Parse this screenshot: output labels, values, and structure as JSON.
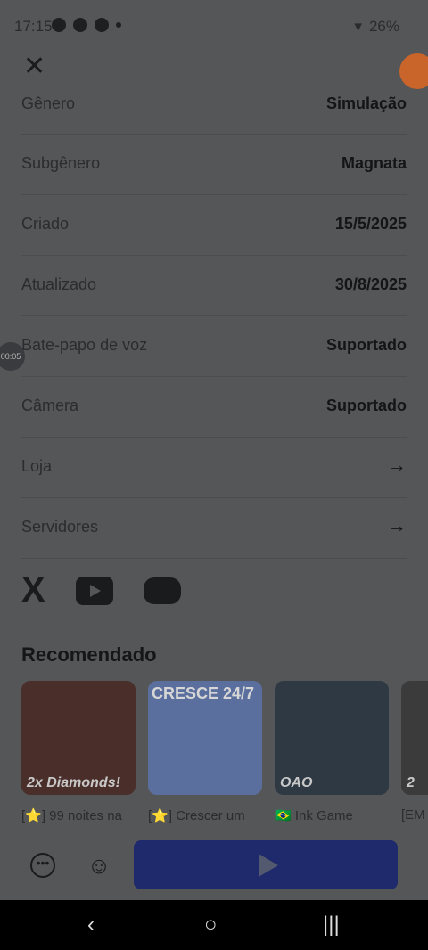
{
  "status": {
    "time": "17:15",
    "battery": "26%"
  },
  "header": {
    "close_icon": "close-icon",
    "fab_icon": "brush-icon"
  },
  "timer_label": "00:05",
  "details": [
    {
      "label": "Gênero",
      "value": "Simulação"
    },
    {
      "label": "Subgênero",
      "value": "Magnata"
    },
    {
      "label": "Criado",
      "value": "15/5/2025"
    },
    {
      "label": "Atualizado",
      "value": "30/8/2025"
    },
    {
      "label": "Bate-papo de voz",
      "value": "Suportado"
    },
    {
      "label": "Câmera",
      "value": "Suportado"
    }
  ],
  "links": [
    {
      "label": "Loja",
      "arrow": "→"
    },
    {
      "label": "Servidores",
      "arrow": "→"
    }
  ],
  "social": [
    "x-icon",
    "youtube-icon",
    "discord-icon"
  ],
  "recommended": {
    "title": "Recomendado",
    "cards": [
      {
        "title": "[⭐] 99 noites na",
        "overlay": "2x Diamonds!"
      },
      {
        "title": "[⭐] Crescer um",
        "overlay": "CRESCE 24/7"
      },
      {
        "title": "🇧🇷 Ink Game",
        "overlay": "OAO"
      },
      {
        "title": "[EM",
        "overlay": "2"
      }
    ]
  },
  "bottom": {
    "play_icon": "play-icon"
  }
}
